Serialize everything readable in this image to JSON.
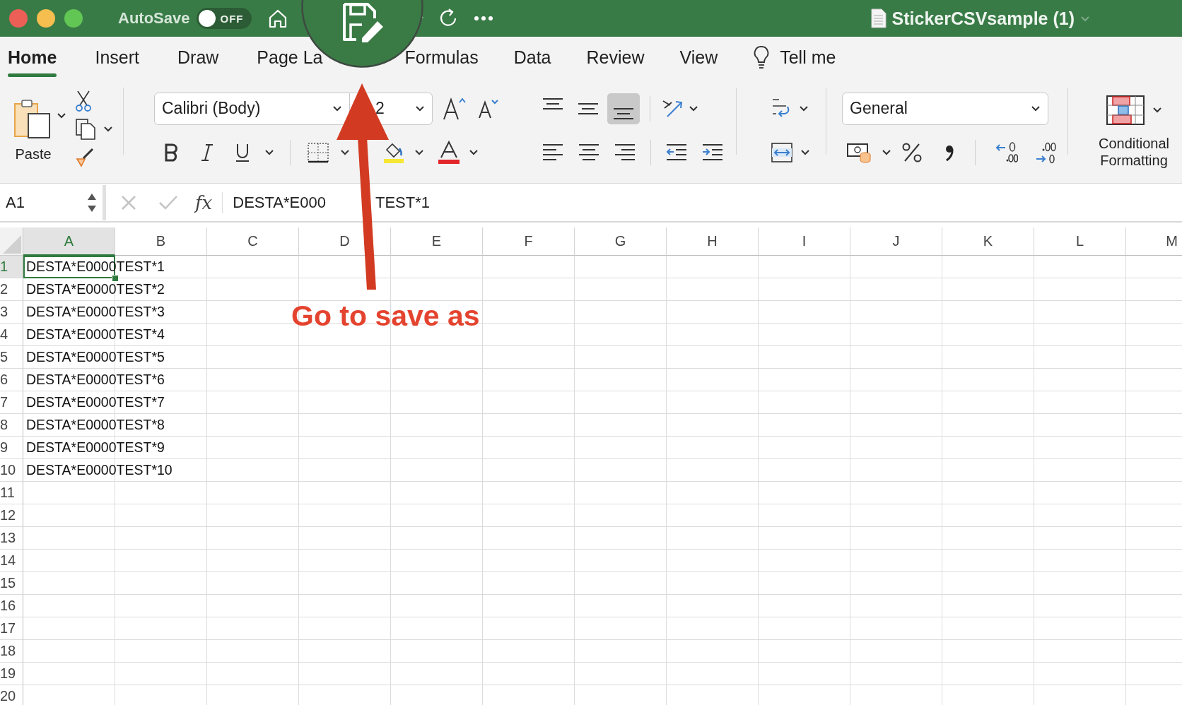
{
  "window": {
    "title": "StickerCSVsample (1)"
  },
  "title_bar": {
    "autosave_label": "AutoSave",
    "autosave": {
      "on": false,
      "label": "OFF"
    }
  },
  "ribbon_tabs": [
    {
      "label": "Home",
      "selected": true
    },
    {
      "label": "Insert",
      "selected": false
    },
    {
      "label": "Draw",
      "selected": false
    },
    {
      "label": "Page La",
      "selected": false
    },
    {
      "label": "Formulas",
      "selected": false
    },
    {
      "label": "Data",
      "selected": false
    },
    {
      "label": "Review",
      "selected": false
    },
    {
      "label": "View",
      "selected": false
    }
  ],
  "tell_me": "Tell me",
  "ribbon": {
    "paste_label": "Paste",
    "font": "Calibri (Body)",
    "font_size": "2",
    "vertical_alignment": [
      {
        "kind": "top",
        "selected": false
      },
      {
        "kind": "middle",
        "selected": false
      },
      {
        "kind": "bottom",
        "selected": true
      }
    ],
    "number_format": "General",
    "conditional_formatting": "Conditional Formatting"
  },
  "formula_bar": {
    "name_box": "A1",
    "function_label": "fx",
    "formula_visible": [
      "DESTA*E000",
      "TEST*1"
    ]
  },
  "sheet": {
    "columns": [
      {
        "label": "A",
        "selected": true
      },
      {
        "label": "B",
        "selected": false
      },
      {
        "label": "C",
        "selected": false
      },
      {
        "label": "D",
        "selected": false
      },
      {
        "label": "E",
        "selected": false
      },
      {
        "label": "F",
        "selected": false
      },
      {
        "label": "G",
        "selected": false
      },
      {
        "label": "H",
        "selected": false
      },
      {
        "label": "I",
        "selected": false
      },
      {
        "label": "J",
        "selected": false
      },
      {
        "label": "K",
        "selected": false
      },
      {
        "label": "L",
        "selected": false
      },
      {
        "label": "M",
        "selected": false
      }
    ],
    "rows": [
      {
        "number": "1",
        "selected": true,
        "cells": [
          {
            "text": "DESTA*E0000TEST*1",
            "active": true
          }
        ]
      },
      {
        "number": "2",
        "selected": false,
        "cells": [
          {
            "text": "DESTA*E0000TEST*2",
            "active": false
          }
        ]
      },
      {
        "number": "3",
        "selected": false,
        "cells": [
          {
            "text": "DESTA*E0000TEST*3",
            "active": false
          }
        ]
      },
      {
        "number": "4",
        "selected": false,
        "cells": [
          {
            "text": "DESTA*E0000TEST*4",
            "active": false
          }
        ]
      },
      {
        "number": "5",
        "selected": false,
        "cells": [
          {
            "text": "DESTA*E0000TEST*5",
            "active": false
          }
        ]
      },
      {
        "number": "6",
        "selected": false,
        "cells": [
          {
            "text": "DESTA*E0000TEST*6",
            "active": false
          }
        ]
      },
      {
        "number": "7",
        "selected": false,
        "cells": [
          {
            "text": "DESTA*E0000TEST*7",
            "active": false
          }
        ]
      },
      {
        "number": "8",
        "selected": false,
        "cells": [
          {
            "text": "DESTA*E0000TEST*8",
            "active": false
          }
        ]
      },
      {
        "number": "9",
        "selected": false,
        "cells": [
          {
            "text": "DESTA*E0000TEST*9",
            "active": false
          }
        ]
      },
      {
        "number": "10",
        "selected": false,
        "cells": [
          {
            "text": "DESTA*E0000TEST*10",
            "active": false
          }
        ]
      },
      {
        "number": "11",
        "selected": false
      },
      {
        "number": "12",
        "selected": false
      },
      {
        "number": "13",
        "selected": false
      },
      {
        "number": "14",
        "selected": false
      },
      {
        "number": "15",
        "selected": false
      },
      {
        "number": "16",
        "selected": false
      },
      {
        "number": "17",
        "selected": false
      },
      {
        "number": "18",
        "selected": false
      },
      {
        "number": "19",
        "selected": false
      },
      {
        "number": "20",
        "selected": false
      }
    ]
  },
  "annotation": {
    "text": "Go to save as"
  }
}
